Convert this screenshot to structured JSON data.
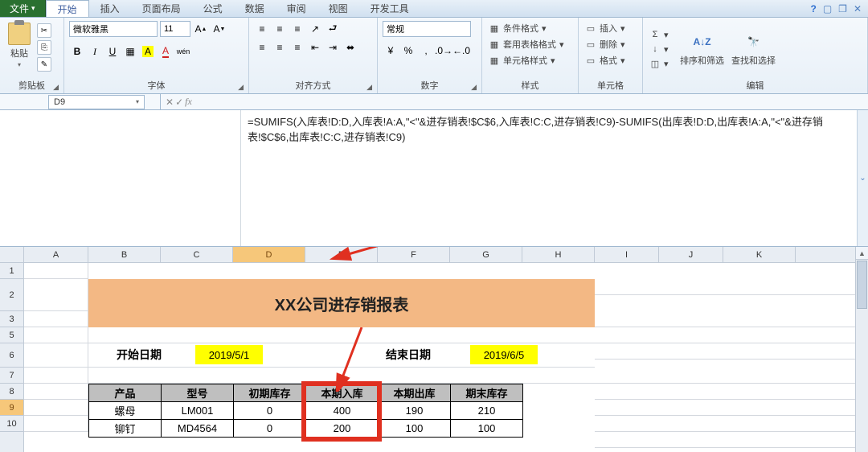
{
  "tabs": {
    "file": "文件",
    "home": "开始",
    "insert": "插入",
    "pageLayout": "页面布局",
    "formulas": "公式",
    "data": "数据",
    "review": "审阅",
    "view": "视图",
    "developer": "开发工具"
  },
  "ribbon": {
    "clipboard": {
      "paste": "粘贴",
      "label": "剪贴板"
    },
    "font": {
      "family": "微软雅黑",
      "size": "11",
      "label": "字体"
    },
    "align": {
      "label": "对齐方式"
    },
    "number": {
      "format": "常规",
      "label": "数字"
    },
    "styles": {
      "cond": "条件格式",
      "tableFmt": "套用表格格式",
      "cellStyle": "单元格样式",
      "label": "样式"
    },
    "cells": {
      "insert": "插入",
      "delete": "删除",
      "format": "格式",
      "label": "单元格"
    },
    "editing": {
      "sort": "排序和筛选",
      "find": "查找和选择",
      "label": "编辑"
    }
  },
  "namebox": "D9",
  "formula": "=SUMIFS(入库表!D:D,入库表!A:A,\"<\"&进存销表!$C$6,入库表!C:C,进存销表!C9)-SUMIFS(出库表!D:D,出库表!A:A,\"<\"&进存销表!$C$6,出库表!C:C,进存销表!C9)",
  "columns": [
    "A",
    "B",
    "C",
    "D",
    "E",
    "F",
    "G",
    "H",
    "I",
    "J",
    "K"
  ],
  "rows": [
    "1",
    "2",
    "3",
    "5",
    "6",
    "7",
    "8",
    "9",
    "10"
  ],
  "sheet": {
    "title": "XX公司进存销报表",
    "startLabel": "开始日期",
    "startDate": "2019/5/1",
    "endLabel": "结束日期",
    "endDate": "2019/6/5",
    "headers": [
      "产品",
      "型号",
      "初期库存",
      "本期入库",
      "本期出库",
      "期末库存"
    ],
    "data": [
      [
        "螺母",
        "LM001",
        "0",
        "400",
        "190",
        "210"
      ],
      [
        "铆钉",
        "MD4564",
        "0",
        "200",
        "100",
        "100"
      ]
    ]
  }
}
